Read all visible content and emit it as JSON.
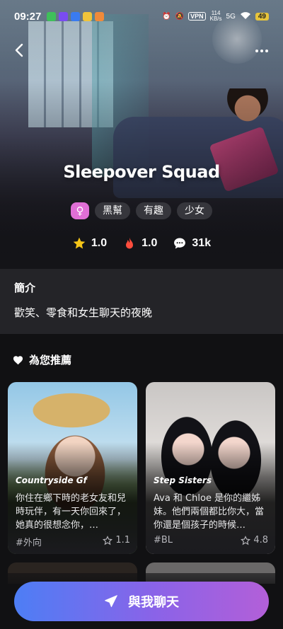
{
  "status_bar": {
    "time": "09:27",
    "vpn": "VPN",
    "net_speed_value": "114",
    "net_speed_unit": "KB/s",
    "network": "5G",
    "battery": "49"
  },
  "character": {
    "name": "Sleepover Squad",
    "gender_symbol": "♀",
    "tags": [
      "黑幫",
      "有趣",
      "少女"
    ],
    "rating": "1.0",
    "popularity": "1.0",
    "chats": "31k"
  },
  "intro": {
    "heading": "簡介",
    "text": "歡笑、零食和女生聊天的夜晚"
  },
  "recommend": {
    "heading": "為您推薦",
    "cards": [
      {
        "title": "Countryside Gf",
        "description": "你住在鄉下時的老女友和兒時玩伴，有一天你回來了，她真的很想念你，…",
        "tag": "#外向",
        "rating": "1.1"
      },
      {
        "title": "Step Sisters",
        "description": "Ava 和 Chloe 是你的繼姊妹。他們兩個都比你大，當你還是個孩子的時候…",
        "tag": "#BL",
        "rating": "4.8"
      }
    ]
  },
  "cta": {
    "label": "與我聊天"
  },
  "colors": {
    "gender_badge": "#e06fd6",
    "star": "#f5c518",
    "fire": "#ff4d3d",
    "cta_gradient_start": "#4d7ef5",
    "cta_gradient_end": "#b35fd8"
  },
  "icons": {
    "back": "chevron-left-icon",
    "more": "more-dots-icon",
    "rating": "star-icon",
    "popularity": "fire-icon",
    "chats": "chat-bubble-icon",
    "recommend": "heart-icon",
    "card_rating": "star-outline-icon",
    "cta": "send-icon"
  }
}
